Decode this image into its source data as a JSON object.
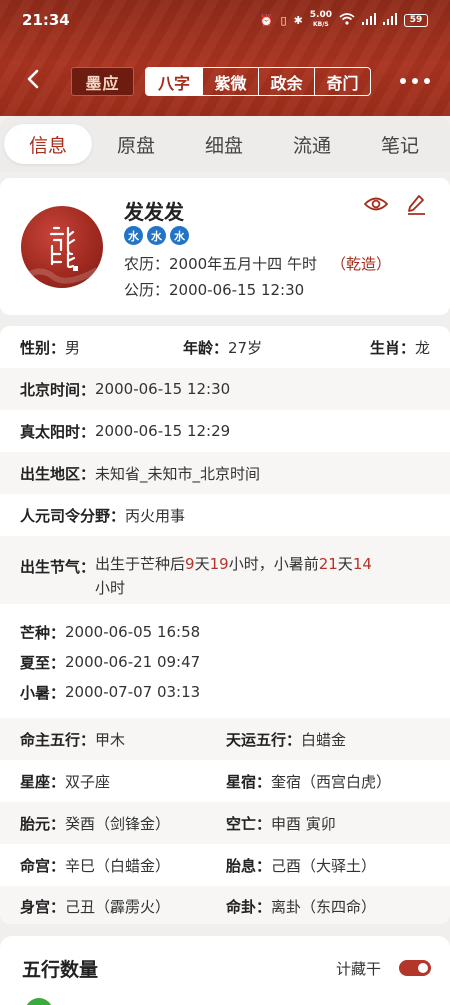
{
  "status": {
    "time": "21:34",
    "net_speed": "5.00",
    "net_unit": "KB/S",
    "battery": "59"
  },
  "nav": {
    "brand": "墨应",
    "modes": [
      {
        "label": "八字",
        "active": true
      },
      {
        "label": "紫微",
        "active": false
      },
      {
        "label": "政余",
        "active": false
      },
      {
        "label": "奇门",
        "active": false
      }
    ]
  },
  "tabs": [
    {
      "label": "信息",
      "active": true
    },
    {
      "label": "原盘",
      "active": false
    },
    {
      "label": "细盘",
      "active": false
    },
    {
      "label": "流通",
      "active": false
    },
    {
      "label": "笔记",
      "active": false
    }
  ],
  "profile": {
    "name": "发发发",
    "elements": [
      "水",
      "水",
      "水"
    ],
    "lunar": "农历：2000年五月十四 午时",
    "qianzao": "（乾造）",
    "solar": "公历：2000-06-15 12:30"
  },
  "basic": {
    "gender_label": "性别：",
    "gender": "男",
    "age_label": "年龄：",
    "age": "27岁",
    "zodiac_label": "生肖：",
    "zodiac": "龙"
  },
  "rows": {
    "beijing_label": "北京时间：",
    "beijing": "2000-06-15 12:30",
    "solar_time_label": "真太阳时：",
    "solar_time": "2000-06-15 12:29",
    "region_label": "出生地区：",
    "region": "未知省_未知市_北京时间",
    "siling_label": "人元司令分野：",
    "siling": "丙火用事"
  },
  "jieqi": {
    "label": "出生节气：",
    "p1": "出生于芒种后",
    "n1": "9",
    "p2": "天",
    "n2": "19",
    "p3": "小时，小暑前",
    "n3": "21",
    "p4": "天",
    "n4": "14",
    "p5": "小时"
  },
  "terms": [
    {
      "label": "芒种：",
      "value": "2000-06-05 16:58"
    },
    {
      "label": "夏至：",
      "value": "2000-06-21 09:47"
    },
    {
      "label": "小暑：",
      "value": "2000-07-07 03:13"
    }
  ],
  "pairs": [
    {
      "l_label": "命主五行：",
      "l_value": "甲木",
      "r_label": "天运五行：",
      "r_value": "白蜡金"
    },
    {
      "l_label": "星座：",
      "l_value": "双子座",
      "r_label": "星宿：",
      "r_value": "奎宿（西宫白虎）"
    },
    {
      "l_label": "胎元：",
      "l_value": "癸酉（剑锋金）",
      "r_label": "空亡：",
      "r_value": "申酉 寅卯"
    },
    {
      "l_label": "命宫：",
      "l_value": "辛巳（白蜡金）",
      "r_label": "胎息：",
      "r_value": "己酉（大驿土）"
    },
    {
      "l_label": "身宫：",
      "l_value": "己丑（霹雳火）",
      "r_label": "命卦：",
      "r_value": "离卦（东四命）"
    }
  ],
  "wuxing": {
    "title": "五行数量",
    "toggle_label": "计藏干",
    "toggle_on": true
  },
  "colors": {
    "header": "#a8331f",
    "accent": "#a62e1d",
    "element_badge": "#2274c6",
    "highlight": "#b4342a"
  }
}
